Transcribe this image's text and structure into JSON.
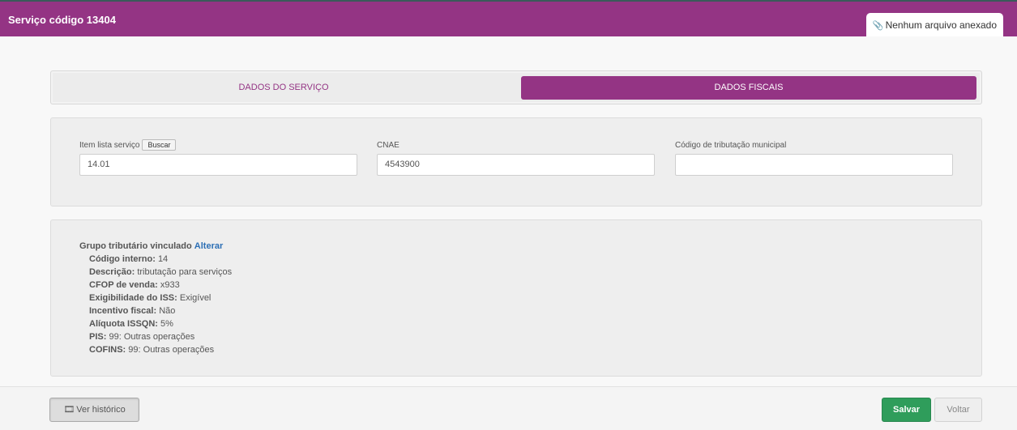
{
  "header": {
    "title": "Serviço código 13404",
    "attachment_label": "Nenhum arquivo anexado",
    "attachment_icon": "paperclip-icon"
  },
  "tabs": [
    {
      "label": "DADOS DO SERVIÇO",
      "active": false
    },
    {
      "label": "DADOS FISCAIS",
      "active": true
    }
  ],
  "fields": {
    "item_lista": {
      "label": "Item lista serviço",
      "button": "Buscar",
      "value": "14.01"
    },
    "cnae": {
      "label": "CNAE",
      "value": "4543900"
    },
    "codigo_tributacao": {
      "label": "Código de tributação municipal",
      "value": ""
    }
  },
  "grupo": {
    "heading": "Grupo tributário vinculado",
    "link": "Alterar",
    "lines": [
      {
        "label": "Código interno:",
        "value": "14"
      },
      {
        "label": "Descrição:",
        "value": "tributação para serviços"
      },
      {
        "label": "CFOP de venda:",
        "value": "x933"
      },
      {
        "label": "Exigibilidade do ISS:",
        "value": "Exigível"
      },
      {
        "label": "Incentivo fiscal:",
        "value": "Não"
      },
      {
        "label": "Alíquota ISSQN:",
        "value": "5%"
      },
      {
        "label": "PIS:",
        "value": "99: Outras operações"
      },
      {
        "label": "COFINS:",
        "value": "99: Outras operações"
      }
    ]
  },
  "footer": {
    "historico_label": "Ver histórico",
    "historico_icon": "film-icon",
    "salvar_label": "Salvar",
    "voltar_label": "Voltar"
  },
  "colors": {
    "brand": "#943484",
    "success": "#2f9d5b",
    "link": "#2c6fb5"
  }
}
